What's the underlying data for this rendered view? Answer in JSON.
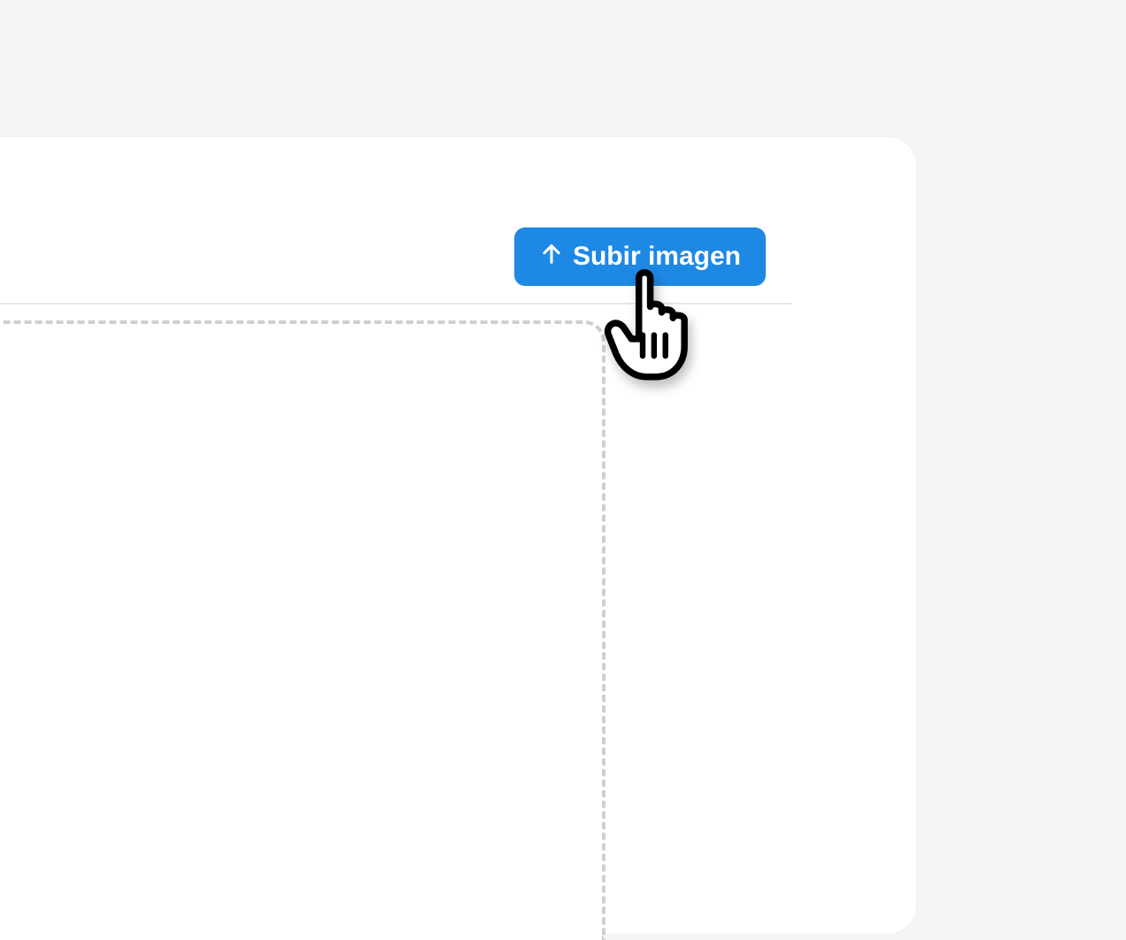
{
  "upload": {
    "button_label": "Subir imagen",
    "icon_name": "arrow-up"
  },
  "colors": {
    "accent": "#1e88e5",
    "panel_bg": "#ffffff",
    "page_bg": "#f5f5f5",
    "dashed_border": "#cfcfcf"
  }
}
